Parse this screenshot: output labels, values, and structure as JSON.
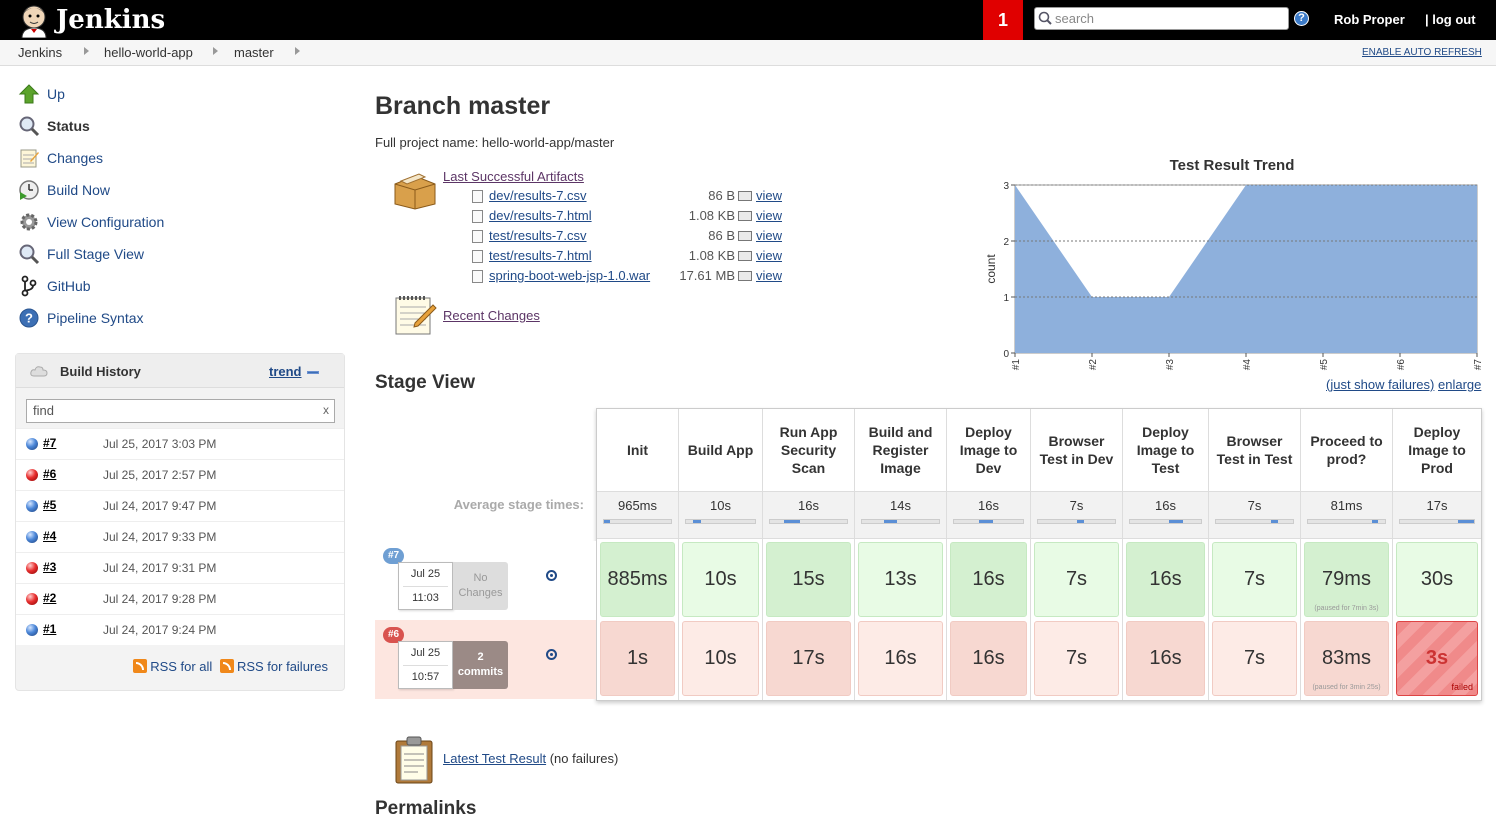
{
  "header": {
    "brand": "Jenkins",
    "notification_count": "1",
    "search_placeholder": "search",
    "help_label": "?",
    "user": "Rob Proper",
    "logout": "| log out"
  },
  "breadcrumb": {
    "items": [
      "Jenkins",
      "hello-world-app",
      "master"
    ],
    "auto_refresh": "ENABLE AUTO REFRESH"
  },
  "sidebar": {
    "tasks": [
      {
        "label": "Up",
        "icon": "up-arrow-icon"
      },
      {
        "label": "Status",
        "icon": "magnifier-icon"
      },
      {
        "label": "Changes",
        "icon": "notepad-icon"
      },
      {
        "label": "Build Now",
        "icon": "clock-play-icon"
      },
      {
        "label": "View Configuration",
        "icon": "gear-icon"
      },
      {
        "label": "Full Stage View",
        "icon": "magnifier-icon"
      },
      {
        "label": "GitHub",
        "icon": "git-branch-icon"
      },
      {
        "label": "Pipeline Syntax",
        "icon": "help-icon"
      }
    ],
    "build_history": {
      "title": "Build History",
      "trend": "trend",
      "find_placeholder": "find",
      "find_clear": "x",
      "builds": [
        {
          "num": "#7",
          "date": "Jul 25, 2017 3:03 PM",
          "status": "blue"
        },
        {
          "num": "#6",
          "date": "Jul 25, 2017 2:57 PM",
          "status": "red"
        },
        {
          "num": "#5",
          "date": "Jul 24, 2017 9:47 PM",
          "status": "blue"
        },
        {
          "num": "#4",
          "date": "Jul 24, 2017 9:33 PM",
          "status": "blue"
        },
        {
          "num": "#3",
          "date": "Jul 24, 2017 9:31 PM",
          "status": "red"
        },
        {
          "num": "#2",
          "date": "Jul 24, 2017 9:28 PM",
          "status": "red"
        },
        {
          "num": "#1",
          "date": "Jul 24, 2017 9:24 PM",
          "status": "blue"
        }
      ],
      "rss_all": "RSS for all",
      "rss_failures": "RSS for failures"
    }
  },
  "main": {
    "title": "Branch master",
    "full_name": "Full project name: hello-world-app/master",
    "artifacts_title": "Last Successful Artifacts",
    "artifacts": [
      {
        "name": "dev/results-7.csv",
        "size": "86 B",
        "view": "view"
      },
      {
        "name": "dev/results-7.html",
        "size": "1.08 KB",
        "view": "view"
      },
      {
        "name": "test/results-7.csv",
        "size": "86 B",
        "view": "view"
      },
      {
        "name": "test/results-7.html",
        "size": "1.08 KB",
        "view": "view"
      },
      {
        "name": "spring-boot-web-jsp-1.0.war",
        "size": "17.61 MB",
        "view": "view"
      }
    ],
    "recent_changes": "Recent Changes",
    "trend": {
      "just_show_failures": "(just show failures)",
      "enlarge": "enlarge"
    },
    "stage_view": {
      "title": "Stage View",
      "avg_label": "Average stage times:",
      "stages": [
        {
          "name": "Init",
          "avg": "965ms",
          "avg_frac": 0.05
        },
        {
          "name": "Build App",
          "avg": "10s",
          "avg_frac": 0.12
        },
        {
          "name": "Run App Security Scan",
          "avg": "16s",
          "avg_frac": 0.2
        },
        {
          "name": "Build and Register Image",
          "avg": "14s",
          "avg_frac": 0.17
        },
        {
          "name": "Deploy Image to Dev",
          "avg": "16s",
          "avg_frac": 0.2
        },
        {
          "name": "Browser Test in Dev",
          "avg": "7s",
          "avg_frac": 0.09
        },
        {
          "name": "Deploy Image to Test",
          "avg": "16s",
          "avg_frac": 0.2
        },
        {
          "name": "Browser Test in Test",
          "avg": "7s",
          "avg_frac": 0.09
        },
        {
          "name": "Proceed to prod?",
          "avg": "81ms",
          "avg_frac": 0.02
        },
        {
          "name": "Deploy Image to Prod",
          "avg": "17s",
          "avg_frac": 0.21
        }
      ],
      "runs": [
        {
          "badge": "#7",
          "date": "Jul 25",
          "time": "11:03",
          "changes": "No Changes",
          "cells": [
            {
              "v": "885ms"
            },
            {
              "v": "10s"
            },
            {
              "v": "15s"
            },
            {
              "v": "13s"
            },
            {
              "v": "16s"
            },
            {
              "v": "7s"
            },
            {
              "v": "16s"
            },
            {
              "v": "7s"
            },
            {
              "v": "79ms",
              "note": "(paused for 7min 3s)"
            },
            {
              "v": "30s"
            }
          ]
        },
        {
          "badge": "#6",
          "date": "Jul 25",
          "time": "10:57",
          "changes": "2 commits",
          "cells": [
            {
              "v": "1s"
            },
            {
              "v": "10s"
            },
            {
              "v": "17s"
            },
            {
              "v": "16s"
            },
            {
              "v": "16s"
            },
            {
              "v": "7s"
            },
            {
              "v": "16s"
            },
            {
              "v": "7s"
            },
            {
              "v": "83ms",
              "note": "(paused for 3min 25s)"
            },
            {
              "v": "3s",
              "failed": "failed"
            }
          ]
        }
      ]
    },
    "latest_test": "Latest Test Result",
    "latest_test_suffix": " (no failures)",
    "permalinks": "Permalinks"
  },
  "chart_data": {
    "type": "area",
    "title": "Test Result Trend",
    "xlabel": "",
    "ylabel": "count",
    "categories": [
      "#1",
      "#2",
      "#3",
      "#4",
      "#5",
      "#6",
      "#7"
    ],
    "series": [
      {
        "values": [
          3,
          1,
          1,
          3,
          3,
          3,
          3
        ]
      }
    ],
    "ylim": [
      0,
      3
    ],
    "yticks": [
      0,
      1,
      2,
      3
    ],
    "grid": true,
    "colors": {
      "fill": "#8eb0dc"
    }
  }
}
